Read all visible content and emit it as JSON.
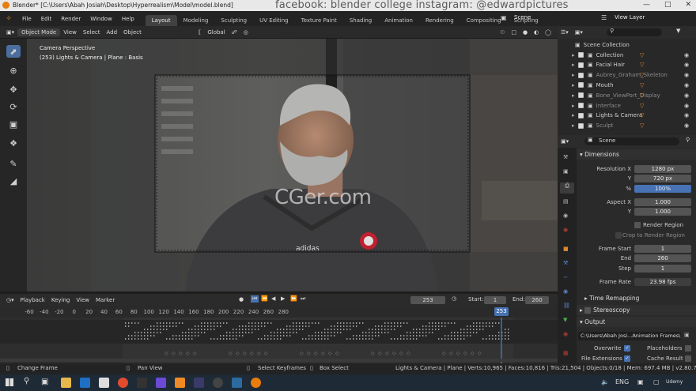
{
  "title": "Blender* [C:\\Users\\Abah Josiah\\Desktop\\Hyperrealism\\Model\\model.blend]",
  "watermark": "facebook: blender college   instagram: @edwardpictures",
  "center_watermark": "CGer.com",
  "menu": [
    "File",
    "Edit",
    "Render",
    "Window",
    "Help"
  ],
  "workspaces": [
    "Layout",
    "Modeling",
    "Sculpting",
    "UV Editing",
    "Texture Paint",
    "Shading",
    "Animation",
    "Rendering",
    "Compositing",
    "Scripting"
  ],
  "scene_name": "Scene",
  "view_layer": "View Layer",
  "viewport_header": {
    "mode": "Object Mode",
    "view": "View",
    "select": "Select",
    "add": "Add",
    "object": "Object",
    "orientation": "Global"
  },
  "viewport": {
    "line1": "Camera Perspective",
    "line2": "(253) Lights & Camera | Plane : Basis"
  },
  "outliner": {
    "root": "Scene Collection",
    "items": [
      {
        "label": "Collection",
        "dim": false
      },
      {
        "label": "Facial Hair",
        "dim": false
      },
      {
        "label": "Aubrey_Graham_Skeleton",
        "dim": true
      },
      {
        "label": "Mouth",
        "dim": false
      },
      {
        "label": "Bone_ViewPort_Display",
        "dim": true
      },
      {
        "label": "Interface",
        "dim": true
      },
      {
        "label": "Lights & Camera",
        "dim": false
      },
      {
        "label": "Sculpt",
        "dim": true
      }
    ]
  },
  "properties": {
    "scene": "Scene",
    "dimensions": "Dimensions",
    "res_x_label": "Resolution X",
    "res_x": "1280 px",
    "y_label": "Y",
    "res_y": "720 px",
    "pct_label": "%",
    "pct": "100%",
    "aspect_x_label": "Aspect X",
    "aspect_x": "1.000",
    "aspect_y": "1.000",
    "render_region": "Render Region",
    "crop_region": "Crop to Render Region",
    "frame_start_label": "Frame Start",
    "frame_start": "1",
    "end_label": "End",
    "frame_end": "260",
    "step_label": "Step",
    "step": "1",
    "frame_rate_label": "Frame Rate",
    "frame_rate": "23.98 fps",
    "time_remapping": "Time Remapping",
    "stereoscopy": "Stereoscopy",
    "output": "Output",
    "output_path": "C:\\Users\\Abah Josi...Animation Frames\\",
    "overwrite": "Overwrite",
    "placeholders": "Placeholders",
    "file_extensions": "File Extensions",
    "cache_result": "Cache Result"
  },
  "timeline": {
    "playback": "Playback",
    "keying": "Keying",
    "view": "View",
    "marker": "Marker",
    "current": "253",
    "start_label": "Start:",
    "start": "1",
    "end_label": "End:",
    "end": "260",
    "ticks": [
      "-60",
      "-40",
      "-20",
      "0",
      "20",
      "40",
      "60",
      "80",
      "100",
      "120",
      "140",
      "160",
      "180",
      "200",
      "220",
      "240",
      "260",
      "280"
    ],
    "current_frame_badge": "253"
  },
  "status": {
    "change_frame": "Change Frame",
    "pan_view": "Pan View",
    "select_keyframes": "Select Keyframes",
    "box_select": "Box Select",
    "stats": "Lights & Camera | Plane | Verts:10,965 | Faces:10,816 | Tris:21,504 | Objects:0/18 | Mem: 697.4 MB | v2.80.75"
  },
  "taskbar": {
    "lang": "ENG",
    "udemy": "Udemy"
  },
  "colors": {
    "accent": "#4772b3",
    "active_tool": "#4b6e9e",
    "orange": "#e08a2c"
  }
}
